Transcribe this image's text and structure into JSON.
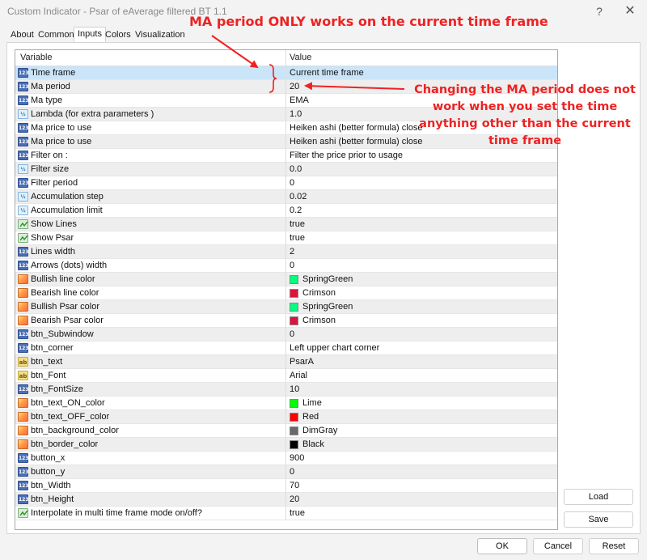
{
  "window": {
    "title": "Custom Indicator - Psar of eAverage filtered BT 1.1",
    "help_glyph": "?",
    "close_glyph": "✕"
  },
  "tabs": [
    {
      "label": "About",
      "active": false
    },
    {
      "label": "Common",
      "active": false
    },
    {
      "label": "Inputs",
      "active": true
    },
    {
      "label": "Colors",
      "active": false
    },
    {
      "label": "Visualization",
      "active": false
    }
  ],
  "grid": {
    "headers": {
      "variable": "Variable",
      "value": "Value"
    },
    "rows": [
      {
        "icon": "int",
        "variable": "Time frame",
        "value": "Current time frame",
        "selected": true
      },
      {
        "icon": "int",
        "variable": "Ma period",
        "value": "20"
      },
      {
        "icon": "int",
        "variable": "Ma type",
        "value": "EMA"
      },
      {
        "icon": "dbl",
        "variable": "Lambda (for extra parameters )",
        "value": "1.0"
      },
      {
        "icon": "int",
        "variable": "Ma price to use",
        "value": "Heiken ashi (better formula) close"
      },
      {
        "icon": "int",
        "variable": "Ma price to use",
        "value": "Heiken ashi (better formula) close"
      },
      {
        "icon": "int",
        "variable": "Filter on :",
        "value": "Filter the price prior to usage"
      },
      {
        "icon": "dbl",
        "variable": "Filter size",
        "value": "0.0"
      },
      {
        "icon": "int",
        "variable": "Filter period",
        "value": "0"
      },
      {
        "icon": "dbl",
        "variable": "Accumulation step",
        "value": "0.02"
      },
      {
        "icon": "dbl",
        "variable": "Accumulation limit",
        "value": "0.2"
      },
      {
        "icon": "bool",
        "variable": "Show Lines",
        "value": "true"
      },
      {
        "icon": "bool",
        "variable": "Show Psar",
        "value": "true"
      },
      {
        "icon": "int",
        "variable": "Lines width",
        "value": "2"
      },
      {
        "icon": "int",
        "variable": "Arrows (dots) width",
        "value": "0"
      },
      {
        "icon": "clr",
        "variable": "Bullish line  color",
        "value": "SpringGreen",
        "swatch": "#00ff7f"
      },
      {
        "icon": "clr",
        "variable": "Bearish line  color",
        "value": "Crimson",
        "swatch": "#dc143c"
      },
      {
        "icon": "clr",
        "variable": "Bullish Psar  color",
        "value": "SpringGreen",
        "swatch": "#00ff7f"
      },
      {
        "icon": "clr",
        "variable": "Bearish Psar  color",
        "value": "Crimson",
        "swatch": "#dc143c"
      },
      {
        "icon": "int",
        "variable": "btn_Subwindow",
        "value": "0"
      },
      {
        "icon": "int",
        "variable": "btn_corner",
        "value": "Left upper chart corner"
      },
      {
        "icon": "str",
        "variable": "btn_text",
        "value": "PsarA"
      },
      {
        "icon": "str",
        "variable": "btn_Font",
        "value": "Arial"
      },
      {
        "icon": "int",
        "variable": "btn_FontSize",
        "value": "10"
      },
      {
        "icon": "clr",
        "variable": "btn_text_ON_color",
        "value": "Lime",
        "swatch": "#00ff00"
      },
      {
        "icon": "clr",
        "variable": "btn_text_OFF_color",
        "value": "Red",
        "swatch": "#ff0000"
      },
      {
        "icon": "clr",
        "variable": "btn_background_color",
        "value": "DimGray",
        "swatch": "#696969"
      },
      {
        "icon": "clr",
        "variable": "btn_border_color",
        "value": "Black",
        "swatch": "#000000"
      },
      {
        "icon": "int",
        "variable": "button_x",
        "value": "900"
      },
      {
        "icon": "int",
        "variable": "button_y",
        "value": "0"
      },
      {
        "icon": "int",
        "variable": "btn_Width",
        "value": "70"
      },
      {
        "icon": "int",
        "variable": "btn_Height",
        "value": "20"
      },
      {
        "icon": "bool",
        "variable": "Interpolate in multi time frame mode on/off?",
        "value": "true"
      }
    ]
  },
  "buttons": {
    "load": "Load",
    "save": "Save",
    "ok": "OK",
    "cancel": "Cancel",
    "reset": "Reset"
  },
  "annotations": {
    "top": "MA period ONLY works on the current time frame",
    "side": "Changing the MA period does not work when you set the time anything other than the current time frame",
    "color": "#ee2222"
  },
  "icon_names": {
    "int": "integer-type-icon",
    "dbl": "double-type-icon",
    "str": "string-type-icon",
    "bool": "boolean-type-icon",
    "clr": "color-type-icon"
  },
  "icon_glyphs": {
    "int": "123",
    "dbl": "½",
    "str": "ab"
  }
}
